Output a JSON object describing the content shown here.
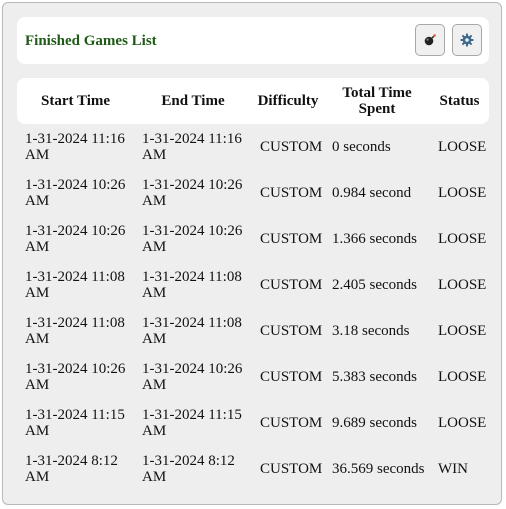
{
  "header": {
    "title": "Finished Games List",
    "bomb_button_icon": "bomb-icon",
    "settings_button_icon": "gear-icon"
  },
  "table": {
    "columns": [
      "Start Time",
      "End Time",
      "Difficulty",
      "Total Time Spent",
      "Status"
    ],
    "rows": [
      {
        "start": "1-31-2024 11:16 AM",
        "end": "1-31-2024 11:16 AM",
        "difficulty": "CUSTOM",
        "total": "0 seconds",
        "status": "LOOSE"
      },
      {
        "start": "1-31-2024 10:26 AM",
        "end": "1-31-2024 10:26 AM",
        "difficulty": "CUSTOM",
        "total": "0.984 second",
        "status": "LOOSE"
      },
      {
        "start": "1-31-2024 10:26 AM",
        "end": "1-31-2024 10:26 AM",
        "difficulty": "CUSTOM",
        "total": "1.366 seconds",
        "status": "LOOSE"
      },
      {
        "start": "1-31-2024 11:08 AM",
        "end": "1-31-2024 11:08 AM",
        "difficulty": "CUSTOM",
        "total": "2.405 seconds",
        "status": "LOOSE"
      },
      {
        "start": "1-31-2024 11:08 AM",
        "end": "1-31-2024 11:08 AM",
        "difficulty": "CUSTOM",
        "total": "3.18 seconds",
        "status": "LOOSE"
      },
      {
        "start": "1-31-2024 10:26 AM",
        "end": "1-31-2024 10:26 AM",
        "difficulty": "CUSTOM",
        "total": "5.383 seconds",
        "status": "LOOSE"
      },
      {
        "start": "1-31-2024 11:15 AM",
        "end": "1-31-2024 11:15 AM",
        "difficulty": "CUSTOM",
        "total": "9.689 seconds",
        "status": "LOOSE"
      },
      {
        "start": "1-31-2024 8:12 AM",
        "end": "1-31-2024 8:12 AM",
        "difficulty": "CUSTOM",
        "total": "36.569 seconds",
        "status": "WIN"
      }
    ]
  },
  "colors": {
    "title": "#1f5a17",
    "panel_background": "#eeeeee",
    "card_background": "#ffffff"
  }
}
